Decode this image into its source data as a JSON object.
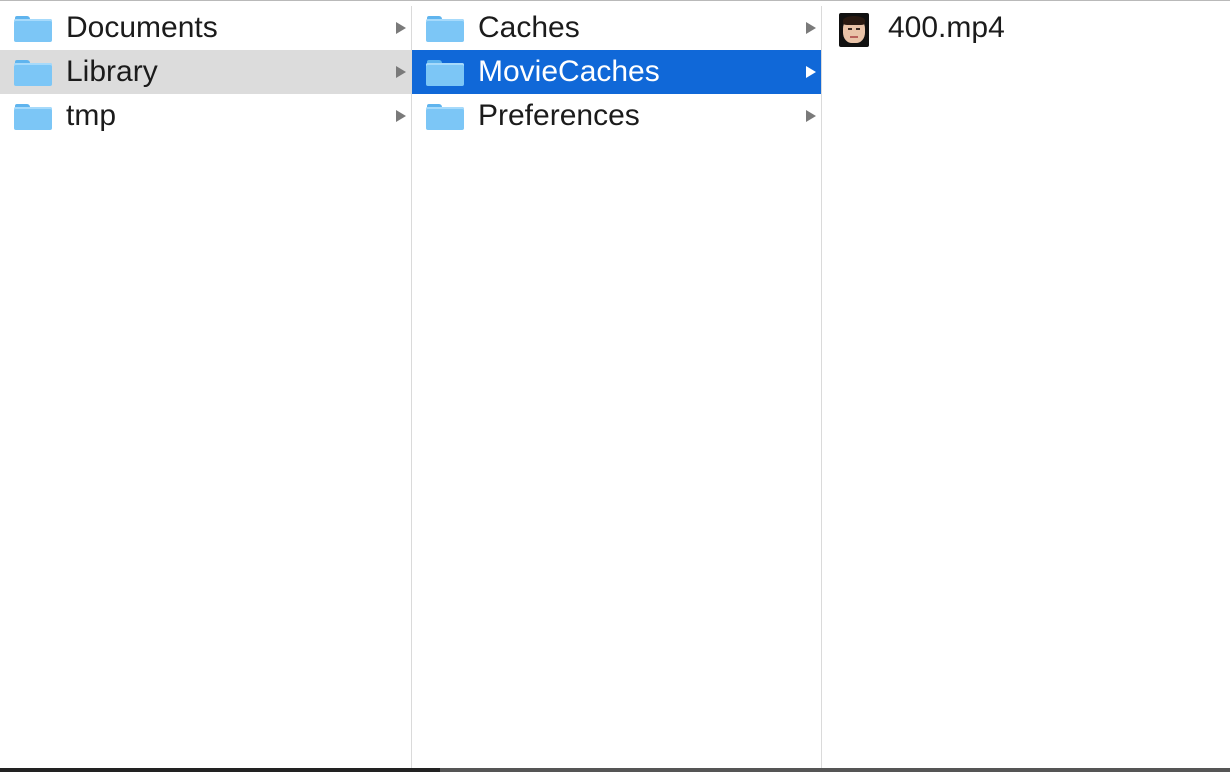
{
  "browser": {
    "column1": [
      {
        "label": "Documents",
        "type": "folder",
        "has_children": true,
        "selected": false
      },
      {
        "label": "Library",
        "type": "folder",
        "has_children": true,
        "selected": "inactive"
      },
      {
        "label": "tmp",
        "type": "folder",
        "has_children": true,
        "selected": false
      }
    ],
    "column2": [
      {
        "label": "Caches",
        "type": "folder",
        "has_children": true,
        "selected": false
      },
      {
        "label": "MovieCaches",
        "type": "folder",
        "has_children": true,
        "selected": "active"
      },
      {
        "label": "Preferences",
        "type": "folder",
        "has_children": true,
        "selected": false
      }
    ],
    "column3": [
      {
        "label": "400.mp4",
        "type": "video-file",
        "icon": "video-thumbnail-icon"
      }
    ]
  },
  "colors": {
    "selection_active": "#1068d8",
    "selection_inactive": "#dcdcdc",
    "folder_blue": "#7cc6f6"
  }
}
